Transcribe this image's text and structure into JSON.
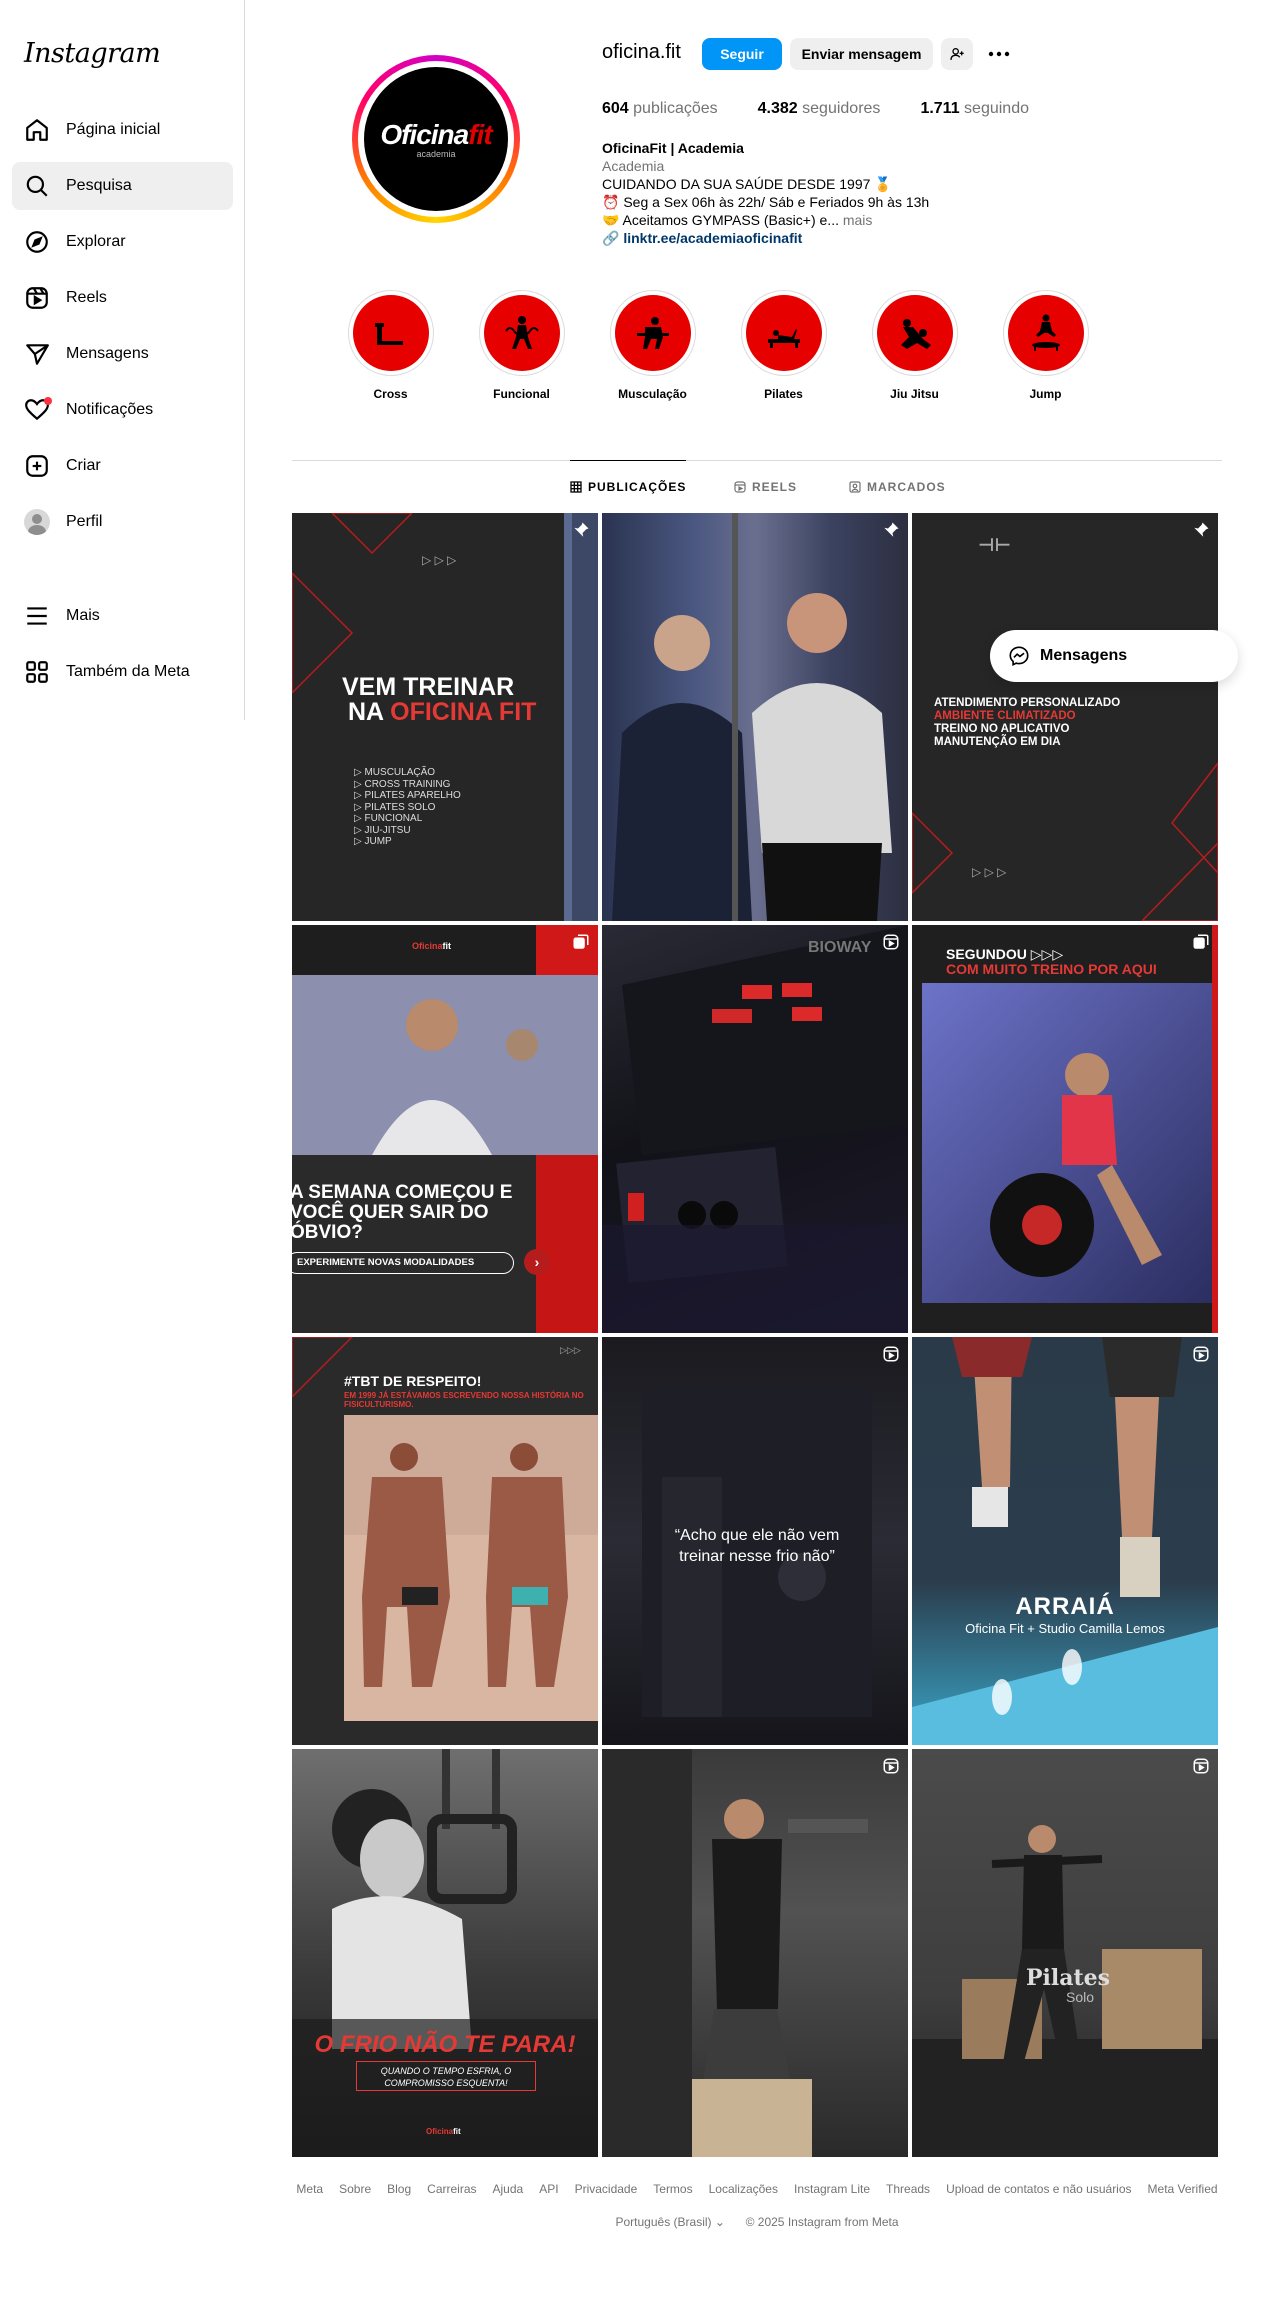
{
  "app": {
    "logo": "Instagram"
  },
  "sidebar": {
    "items": [
      {
        "label": "Página inicial",
        "icon": "home-icon"
      },
      {
        "label": "Pesquisa",
        "icon": "search-icon",
        "active": true
      },
      {
        "label": "Explorar",
        "icon": "compass-icon"
      },
      {
        "label": "Reels",
        "icon": "reels-icon"
      },
      {
        "label": "Mensagens",
        "icon": "send-icon"
      },
      {
        "label": "Notificações",
        "icon": "heart-icon"
      },
      {
        "label": "Criar",
        "icon": "plus-square-icon"
      },
      {
        "label": "Perfil",
        "icon": "avatar"
      }
    ],
    "more_label": "Mais",
    "meta_label": "Também da Meta"
  },
  "profile": {
    "pic_brand_main": "Oficina",
    "pic_brand_accent": "fit",
    "pic_sub": "academia",
    "username": "oficina.fit",
    "follow_label": "Seguir",
    "message_label": "Enviar mensagem",
    "stats": {
      "posts_count": "604",
      "posts_label": "publicações",
      "followers_count": "4.382",
      "followers_label": "seguidores",
      "following_count": "1.711",
      "following_label": "seguindo"
    },
    "bio": {
      "name": "OficinaFit | Academia",
      "category": "Academia",
      "line1": "CUIDANDO DA SUA SAÚDE DESDE 1997 🏅",
      "line2": "⏰ Seg a Sex 06h às 22h/ Sáb e Feriados 9h às 13h",
      "line3": "🤝 Aceitamos GYMPASS (Basic+) e...",
      "more": "mais",
      "link": "linktr.ee/academiaoficinafit"
    }
  },
  "highlights": [
    {
      "label": "Cross"
    },
    {
      "label": "Funcional"
    },
    {
      "label": "Musculação"
    },
    {
      "label": "Pilates"
    },
    {
      "label": "Jiu Jitsu"
    },
    {
      "label": "Jump"
    }
  ],
  "tabs": {
    "posts": "PUBLICAÇÕES",
    "reels": "REELS",
    "tagged": "MARCADOS"
  },
  "posts": {
    "p1": {
      "title_a": "VEM TREINAR",
      "title_b": "NA",
      "title_c": "OFICINA FIT",
      "list": [
        "▷ MUSCULAÇÃO",
        "▷ CROSS TRAINING",
        "▷ PILATES APARELHO",
        "▷ PILATES SOLO",
        "▷ FUNCIONAL",
        "▷ JIU-JITSU",
        "▷ JUMP"
      ]
    },
    "p3": {
      "line1": "ATENDIMENTO PERSONALIZADO",
      "line2": "AMBIENTE CLIMATIZADO",
      "line3": "TREINO NO APLICATIVO",
      "line4": "MANUTENÇÃO EM DIA"
    },
    "p4": {
      "headline": "A SEMANA COMEÇOU E VOCÊ QUER SAIR DO ÓBVIO?",
      "cta": "EXPERIMENTE NOVAS MODALIDADES"
    },
    "p5": {
      "brand": "BIOWAY"
    },
    "p6": {
      "line1": "SEGUNDOU ▷▷▷",
      "line2": "COM MUITO TREINO POR AQUI"
    },
    "p7": {
      "title": "#TBT DE RESPEITO!",
      "sub": "EM 1999 JÁ ESTÁVAMOS ESCREVENDO NOSSA HISTÓRIA NO FISICULTURISMO."
    },
    "p8": {
      "quote": "“Acho que ele não vem treinar nesse frio não”"
    },
    "p9": {
      "title": "ARRAIÁ",
      "sub": "Oficina Fit + Studio Camilla Lemos"
    },
    "p10": {
      "title": "O FRIO NÃO TE PARA!",
      "sub": "QUANDO O TEMPO ESFRIA, O COMPROMISSO ESQUENTA!"
    },
    "p12": {
      "title": "Pilates",
      "sub": "Solo"
    }
  },
  "messages_pill": "Mensagens",
  "footer": {
    "links": [
      "Meta",
      "Sobre",
      "Blog",
      "Carreiras",
      "Ajuda",
      "API",
      "Privacidade",
      "Termos",
      "Localizações",
      "Instagram Lite",
      "Threads",
      "Upload de contatos e não usuários",
      "Meta Verified"
    ],
    "language": "Português (Brasil) ⌄",
    "copyright": "© 2025 Instagram from Meta"
  }
}
